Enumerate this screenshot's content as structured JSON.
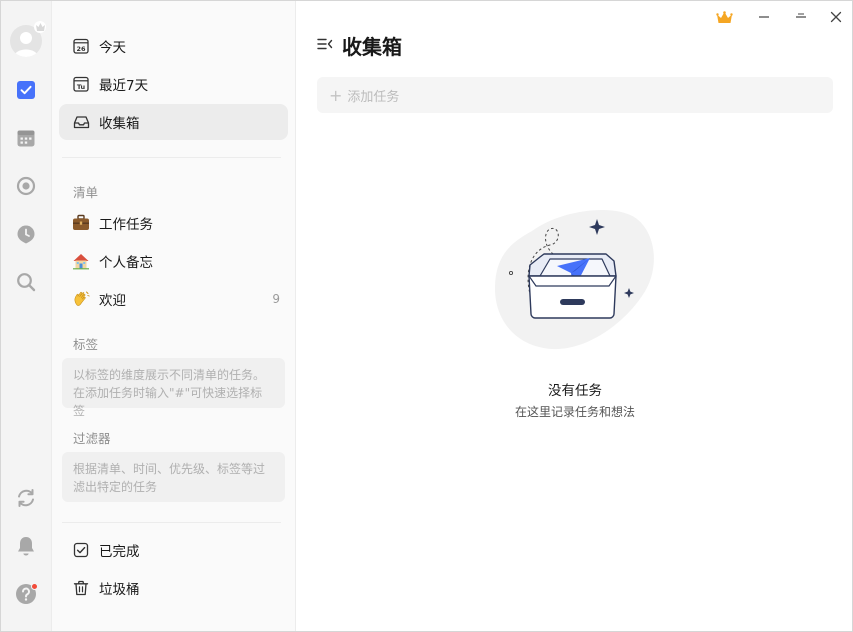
{
  "main": {
    "title": "收集箱",
    "add_task_placeholder": "添加任务",
    "empty_title": "没有任务",
    "empty_subtitle": "在这里记录任务和想法"
  },
  "sidebar": {
    "smart_lists": [
      {
        "label": "今天",
        "icon": "calendar-26-icon",
        "date_badge": "26"
      },
      {
        "label": "最近7天",
        "icon": "calendar-tu-icon",
        "date_badge": "Tu"
      },
      {
        "label": "收集箱",
        "icon": "inbox-icon",
        "active": true
      }
    ],
    "lists_heading": "清单",
    "lists": [
      {
        "label": "工作任务",
        "icon": "briefcase-emoji-icon"
      },
      {
        "label": "个人备忘",
        "icon": "house-emoji-icon"
      },
      {
        "label": "欢迎",
        "icon": "waving-hand-emoji-icon",
        "count": "9"
      }
    ],
    "tags_heading": "标签",
    "tags_hint": "以标签的维度展示不同清单的任务。在添加任务时输入\"#\"可快速选择标签",
    "filters_heading": "过滤器",
    "filters_hint": "根据清单、时间、优先级、标签等过滤出特定的任务",
    "footer": [
      {
        "label": "已完成",
        "icon": "checkbox-done-icon"
      },
      {
        "label": "垃圾桶",
        "icon": "trash-icon"
      }
    ]
  },
  "rail": {
    "items": [
      "avatar",
      "task-checkbox-icon",
      "calendar-icon",
      "focus-icon",
      "habit-icon",
      "search-icon",
      "sync-icon",
      "bell-icon",
      "help-icon"
    ]
  },
  "colors": {
    "accent": "#4772fa",
    "premium": "#f5a623",
    "sidebar_bg": "#fafafa",
    "rail_bg": "#f4f4f4",
    "active_item": "#ececec",
    "notify_dot": "#f24b3a"
  }
}
